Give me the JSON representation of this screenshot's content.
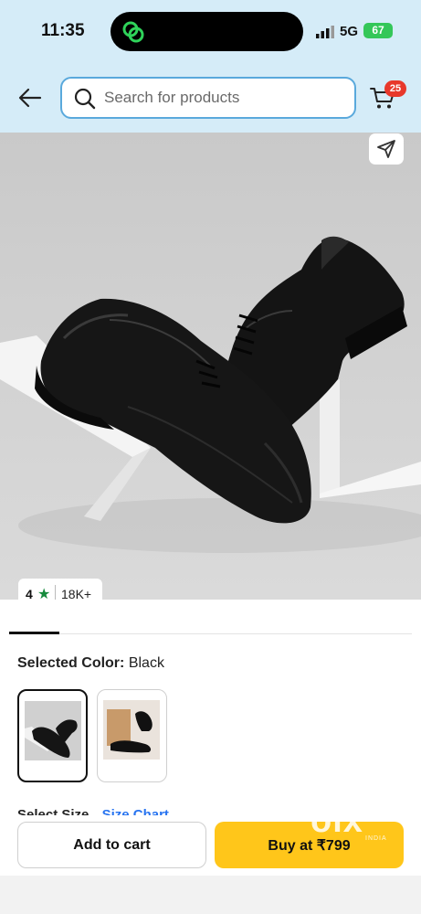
{
  "status_bar": {
    "time": "11:35",
    "network": "5G",
    "battery": "67"
  },
  "header": {
    "search_placeholder": "Search for products",
    "cart_count": "25"
  },
  "product": {
    "rating_value": "4",
    "rating_count": "18K+"
  },
  "color_selector": {
    "label": "Selected Color:",
    "value": "Black"
  },
  "size_selector": {
    "label": "Select Size",
    "size_chart_link": "Size Chart"
  },
  "actions": {
    "add_to_cart": "Add to cart",
    "buy_now": "Buy at ₹799"
  },
  "watermark": {
    "logo": "olx",
    "sub": "INDIA"
  },
  "icons": [
    "back-arrow-icon",
    "search-icon",
    "cart-icon",
    "share-icon",
    "star-icon",
    "signal-icon",
    "battery-icon",
    "loop-icon"
  ],
  "colors": {
    "header_bg": "#d5ecf8",
    "search_border": "#5aa9dc",
    "badge_red": "#e8382b",
    "rating_green": "#168a3c",
    "buy_yellow": "#ffc61a",
    "link_blue": "#2874f0",
    "battery_green": "#34c759"
  }
}
